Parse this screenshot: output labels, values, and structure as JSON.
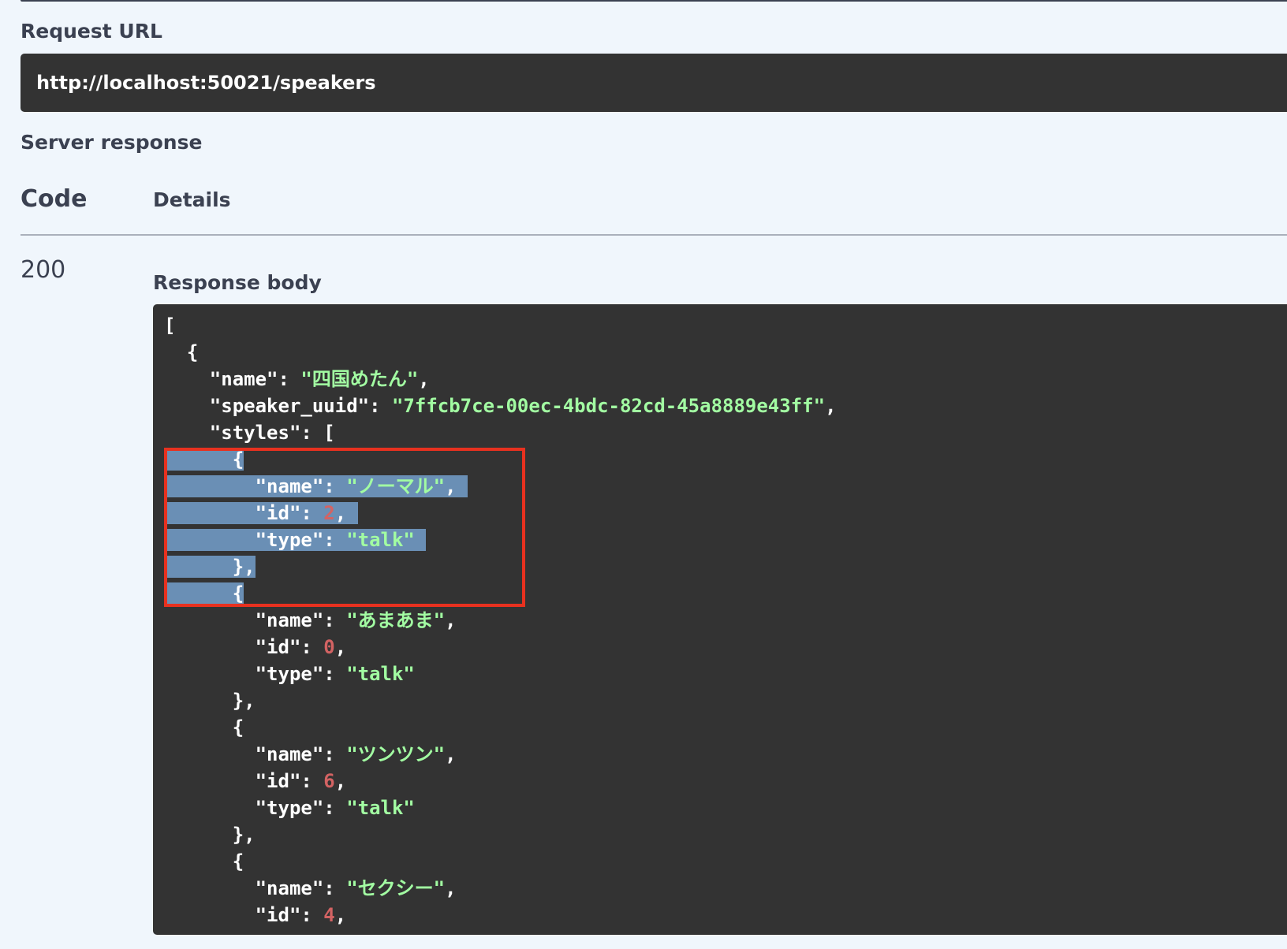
{
  "request": {
    "label": "Request URL",
    "url": "http://localhost:50021/speakers"
  },
  "server_response": {
    "label": "Server response",
    "columns": {
      "code": "Code",
      "details": "Details"
    },
    "status_code": "200",
    "body_label": "Response body"
  },
  "colors": {
    "code_background": "#333333",
    "string": "#a2fca2",
    "number": "#d36363",
    "selection": "#6a8fb5",
    "annotation_box": "#e8311f"
  },
  "response_body": {
    "lines": [
      {
        "parts": [
          {
            "t": "[",
            "c": "p"
          }
        ]
      },
      {
        "parts": [
          {
            "t": "  {",
            "c": "p"
          }
        ]
      },
      {
        "parts": [
          {
            "t": "    \"name\": ",
            "c": "p"
          },
          {
            "t": "\"四国めたん\"",
            "c": "str"
          },
          {
            "t": ",",
            "c": "p"
          }
        ]
      },
      {
        "parts": [
          {
            "t": "    \"speaker_uuid\": ",
            "c": "p"
          },
          {
            "t": "\"7ffcb7ce-00ec-4bdc-82cd-45a8889e43ff\"",
            "c": "str"
          },
          {
            "t": ",",
            "c": "p"
          }
        ]
      },
      {
        "parts": [
          {
            "t": "    \"styles\": [",
            "c": "p"
          }
        ]
      },
      {
        "parts": [
          {
            "t": "      {",
            "c": "p",
            "sel": true
          }
        ]
      },
      {
        "parts": [
          {
            "t": "        \"name\": ",
            "c": "p",
            "sel": true
          },
          {
            "t": "\"ノーマル\"",
            "c": "str",
            "sel": true
          },
          {
            "t": ", ",
            "c": "p",
            "sel": true
          }
        ]
      },
      {
        "parts": [
          {
            "t": "        \"id\": ",
            "c": "p",
            "sel": true
          },
          {
            "t": "2",
            "c": "num",
            "sel": true
          },
          {
            "t": ", ",
            "c": "p",
            "sel": true
          }
        ]
      },
      {
        "parts": [
          {
            "t": "        \"type\": ",
            "c": "p",
            "sel": true
          },
          {
            "t": "\"talk\" ",
            "c": "str",
            "sel": true
          }
        ]
      },
      {
        "parts": [
          {
            "t": "      },",
            "c": "p",
            "sel": true
          }
        ]
      },
      {
        "parts": [
          {
            "t": "      {",
            "c": "p",
            "sel": true
          }
        ]
      },
      {
        "parts": [
          {
            "t": "        \"name\": ",
            "c": "p"
          },
          {
            "t": "\"あまあま\"",
            "c": "str"
          },
          {
            "t": ",",
            "c": "p"
          }
        ]
      },
      {
        "parts": [
          {
            "t": "        \"id\": ",
            "c": "p"
          },
          {
            "t": "0",
            "c": "num"
          },
          {
            "t": ",",
            "c": "p"
          }
        ]
      },
      {
        "parts": [
          {
            "t": "        \"type\": ",
            "c": "p"
          },
          {
            "t": "\"talk\"",
            "c": "str"
          }
        ]
      },
      {
        "parts": [
          {
            "t": "      },",
            "c": "p"
          }
        ]
      },
      {
        "parts": [
          {
            "t": "      {",
            "c": "p"
          }
        ]
      },
      {
        "parts": [
          {
            "t": "        \"name\": ",
            "c": "p"
          },
          {
            "t": "\"ツンツン\"",
            "c": "str"
          },
          {
            "t": ",",
            "c": "p"
          }
        ]
      },
      {
        "parts": [
          {
            "t": "        \"id\": ",
            "c": "p"
          },
          {
            "t": "6",
            "c": "num"
          },
          {
            "t": ",",
            "c": "p"
          }
        ]
      },
      {
        "parts": [
          {
            "t": "        \"type\": ",
            "c": "p"
          },
          {
            "t": "\"talk\"",
            "c": "str"
          }
        ]
      },
      {
        "parts": [
          {
            "t": "      },",
            "c": "p"
          }
        ]
      },
      {
        "parts": [
          {
            "t": "      {",
            "c": "p"
          }
        ]
      },
      {
        "parts": [
          {
            "t": "        \"name\": ",
            "c": "p"
          },
          {
            "t": "\"セクシー\"",
            "c": "str"
          },
          {
            "t": ",",
            "c": "p"
          }
        ]
      },
      {
        "parts": [
          {
            "t": "        \"id\": ",
            "c": "p"
          },
          {
            "t": "4",
            "c": "num"
          },
          {
            "t": ",",
            "c": "p"
          }
        ]
      }
    ]
  }
}
